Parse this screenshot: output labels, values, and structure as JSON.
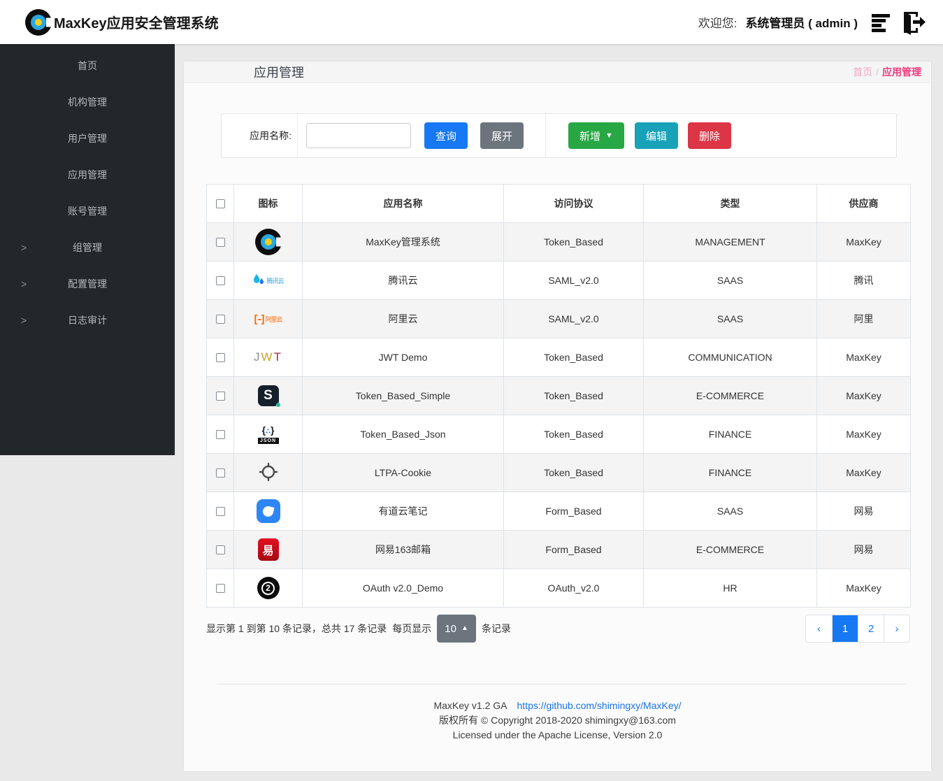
{
  "header": {
    "brand": "MaxKey应用安全管理系统",
    "welcome_label": "欢迎您:",
    "user": "系统管理员 ( admin )"
  },
  "sidebar": {
    "items": [
      {
        "label": "首页"
      },
      {
        "label": "机构管理"
      },
      {
        "label": "用户管理"
      },
      {
        "label": "应用管理"
      },
      {
        "label": "账号管理"
      },
      {
        "label": "组管理",
        "has_children": true
      },
      {
        "label": "配置管理",
        "has_children": true
      },
      {
        "label": "日志审计",
        "has_children": true
      }
    ]
  },
  "breadcrumb": {
    "page_title": "应用管理",
    "home": "首页",
    "separator": "/",
    "current": "应用管理"
  },
  "toolbar": {
    "search_label": "应用名称:",
    "search_value": "",
    "query_label": "查询",
    "expand_label": "展开",
    "add_label": "新增",
    "edit_label": "编辑",
    "delete_label": "删除"
  },
  "table": {
    "headers": [
      "图标",
      "应用名称",
      "访问协议",
      "类型",
      "供应商"
    ],
    "icon_labels": {
      "tencent": "腾讯云",
      "aliyun_bracket": "[-]",
      "aliyun": "阿里云",
      "jwt_j": "J",
      "jwt_w": "W",
      "jwt_t": "T",
      "s_badge": "S",
      "json_braces_open": "{",
      "json_dots": "∴",
      "json_braces_close": "}",
      "json_band": "JSON",
      "netease": "易",
      "oauth": "2"
    },
    "rows": [
      {
        "icon": "maxkey-logo",
        "name": "MaxKey管理系统",
        "protocol": "Token_Based",
        "category": "MANAGEMENT",
        "vendor": "MaxKey"
      },
      {
        "icon": "tencent-cloud",
        "name": "腾讯云",
        "protocol": "SAML_v2.0",
        "category": "SAAS",
        "vendor": "腾讯"
      },
      {
        "icon": "aliyun",
        "name": "阿里云",
        "protocol": "SAML_v2.0",
        "category": "SAAS",
        "vendor": "阿里"
      },
      {
        "icon": "jwt",
        "name": "JWT Demo",
        "protocol": "Token_Based",
        "category": "COMMUNICATION",
        "vendor": "MaxKey"
      },
      {
        "icon": "s-badge",
        "name": "Token_Based_Simple",
        "protocol": "Token_Based",
        "category": "E-COMMERCE",
        "vendor": "MaxKey"
      },
      {
        "icon": "json-badge",
        "name": "Token_Based_Json",
        "protocol": "Token_Based",
        "category": "FINANCE",
        "vendor": "MaxKey"
      },
      {
        "icon": "ltpa-target",
        "name": "LTPA-Cookie",
        "protocol": "Token_Based",
        "category": "FINANCE",
        "vendor": "MaxKey"
      },
      {
        "icon": "youdao-note",
        "name": "有道云笔记",
        "protocol": "Form_Based",
        "category": "SAAS",
        "vendor": "网易"
      },
      {
        "icon": "netease-163",
        "name": "网易163邮箱",
        "protocol": "Form_Based",
        "category": "E-COMMERCE",
        "vendor": "网易"
      },
      {
        "icon": "oauth2",
        "name": "OAuth v2.0_Demo",
        "protocol": "OAuth_v2.0",
        "category": "HR",
        "vendor": "MaxKey"
      }
    ]
  },
  "pagination": {
    "info": "显示第 1 到第 10 条记录，总共 17 条记录",
    "per_page_label": "每页显示",
    "page_size": "10",
    "records_suffix": "条记录",
    "prev": "‹",
    "page1": "1",
    "page2": "2",
    "next": "›"
  },
  "footer": {
    "version": "MaxKey  v1.2 GA",
    "link": "https://github.com/shimingxy/MaxKey/",
    "copyright": "版权所有 © Copyright 2018-2020 shimingxy@163.com",
    "license": "Licensed under the Apache License, Version 2.0"
  },
  "colors": {
    "primary": "#1678f2",
    "success": "#28a745",
    "info": "#17a2b8",
    "danger": "#dc3545",
    "secondary": "#6c757d",
    "breadcrumb_pink": "#ee3b7d",
    "sidebar_bg": "#23272b",
    "link_blue": "#1a73e8"
  }
}
